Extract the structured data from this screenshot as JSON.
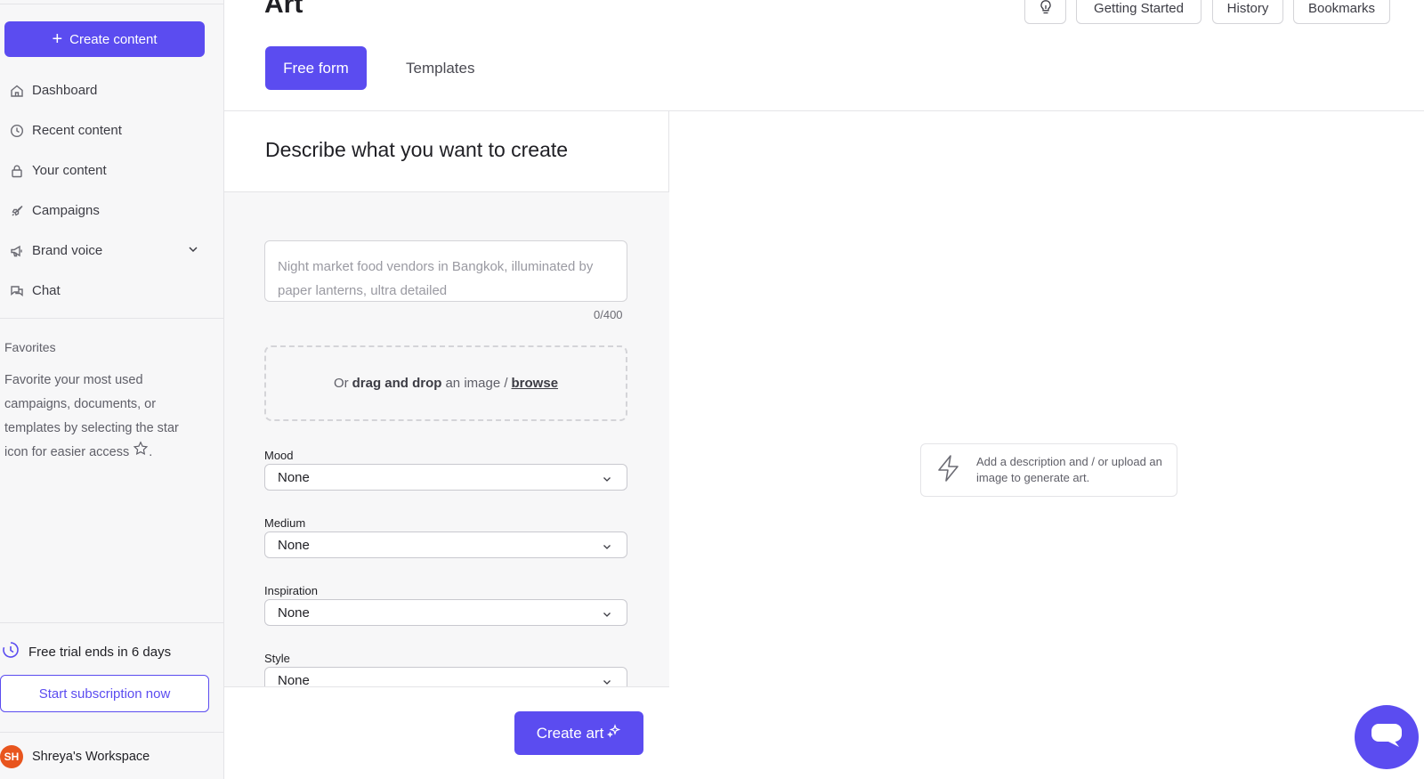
{
  "header": {
    "title": "Art",
    "buttons": {
      "getting_started": "Getting Started",
      "history": "History",
      "bookmarks": "Bookmarks"
    },
    "tabs": {
      "free_form": "Free form",
      "templates": "Templates"
    }
  },
  "sidebar": {
    "create_label": "Create content",
    "items": [
      {
        "label": "Dashboard",
        "icon": "home-icon"
      },
      {
        "label": "Recent content",
        "icon": "clock-icon"
      },
      {
        "label": "Your content",
        "icon": "lock-icon"
      },
      {
        "label": "Campaigns",
        "icon": "rocket-icon"
      },
      {
        "label": "Brand voice",
        "icon": "megaphone-icon"
      },
      {
        "label": "Chat",
        "icon": "chat-icon"
      }
    ],
    "favorites_title": "Favorites",
    "favorites_text": "Favorite your most used campaigns, documents, or templates by selecting the star icon for easier access",
    "favorites_suffix": ".",
    "trial_text": "Free trial ends in 6 days",
    "subscribe_label": "Start subscription now",
    "workspace_initials": "SH",
    "workspace_name": "Shreya's Workspace"
  },
  "form": {
    "heading": "Describe what you want to create",
    "prompt_placeholder": "Night market food vendors in Bangkok, illuminated by paper lanterns, ultra detailed",
    "counter": "0/400",
    "drop_prefix": "Or",
    "drop_bold": "drag and drop",
    "drop_middle": "an image /",
    "drop_link": "browse",
    "fields": [
      {
        "label": "Mood",
        "value": "None"
      },
      {
        "label": "Medium",
        "value": "None"
      },
      {
        "label": "Inspiration",
        "value": "None"
      },
      {
        "label": "Style",
        "value": "None"
      }
    ],
    "submit_label": "Create art"
  },
  "preview": {
    "hint": "Add a description and / or upload an image to generate art."
  },
  "colors": {
    "accent": "#5b4cf0",
    "avatar": "#e8551e"
  }
}
